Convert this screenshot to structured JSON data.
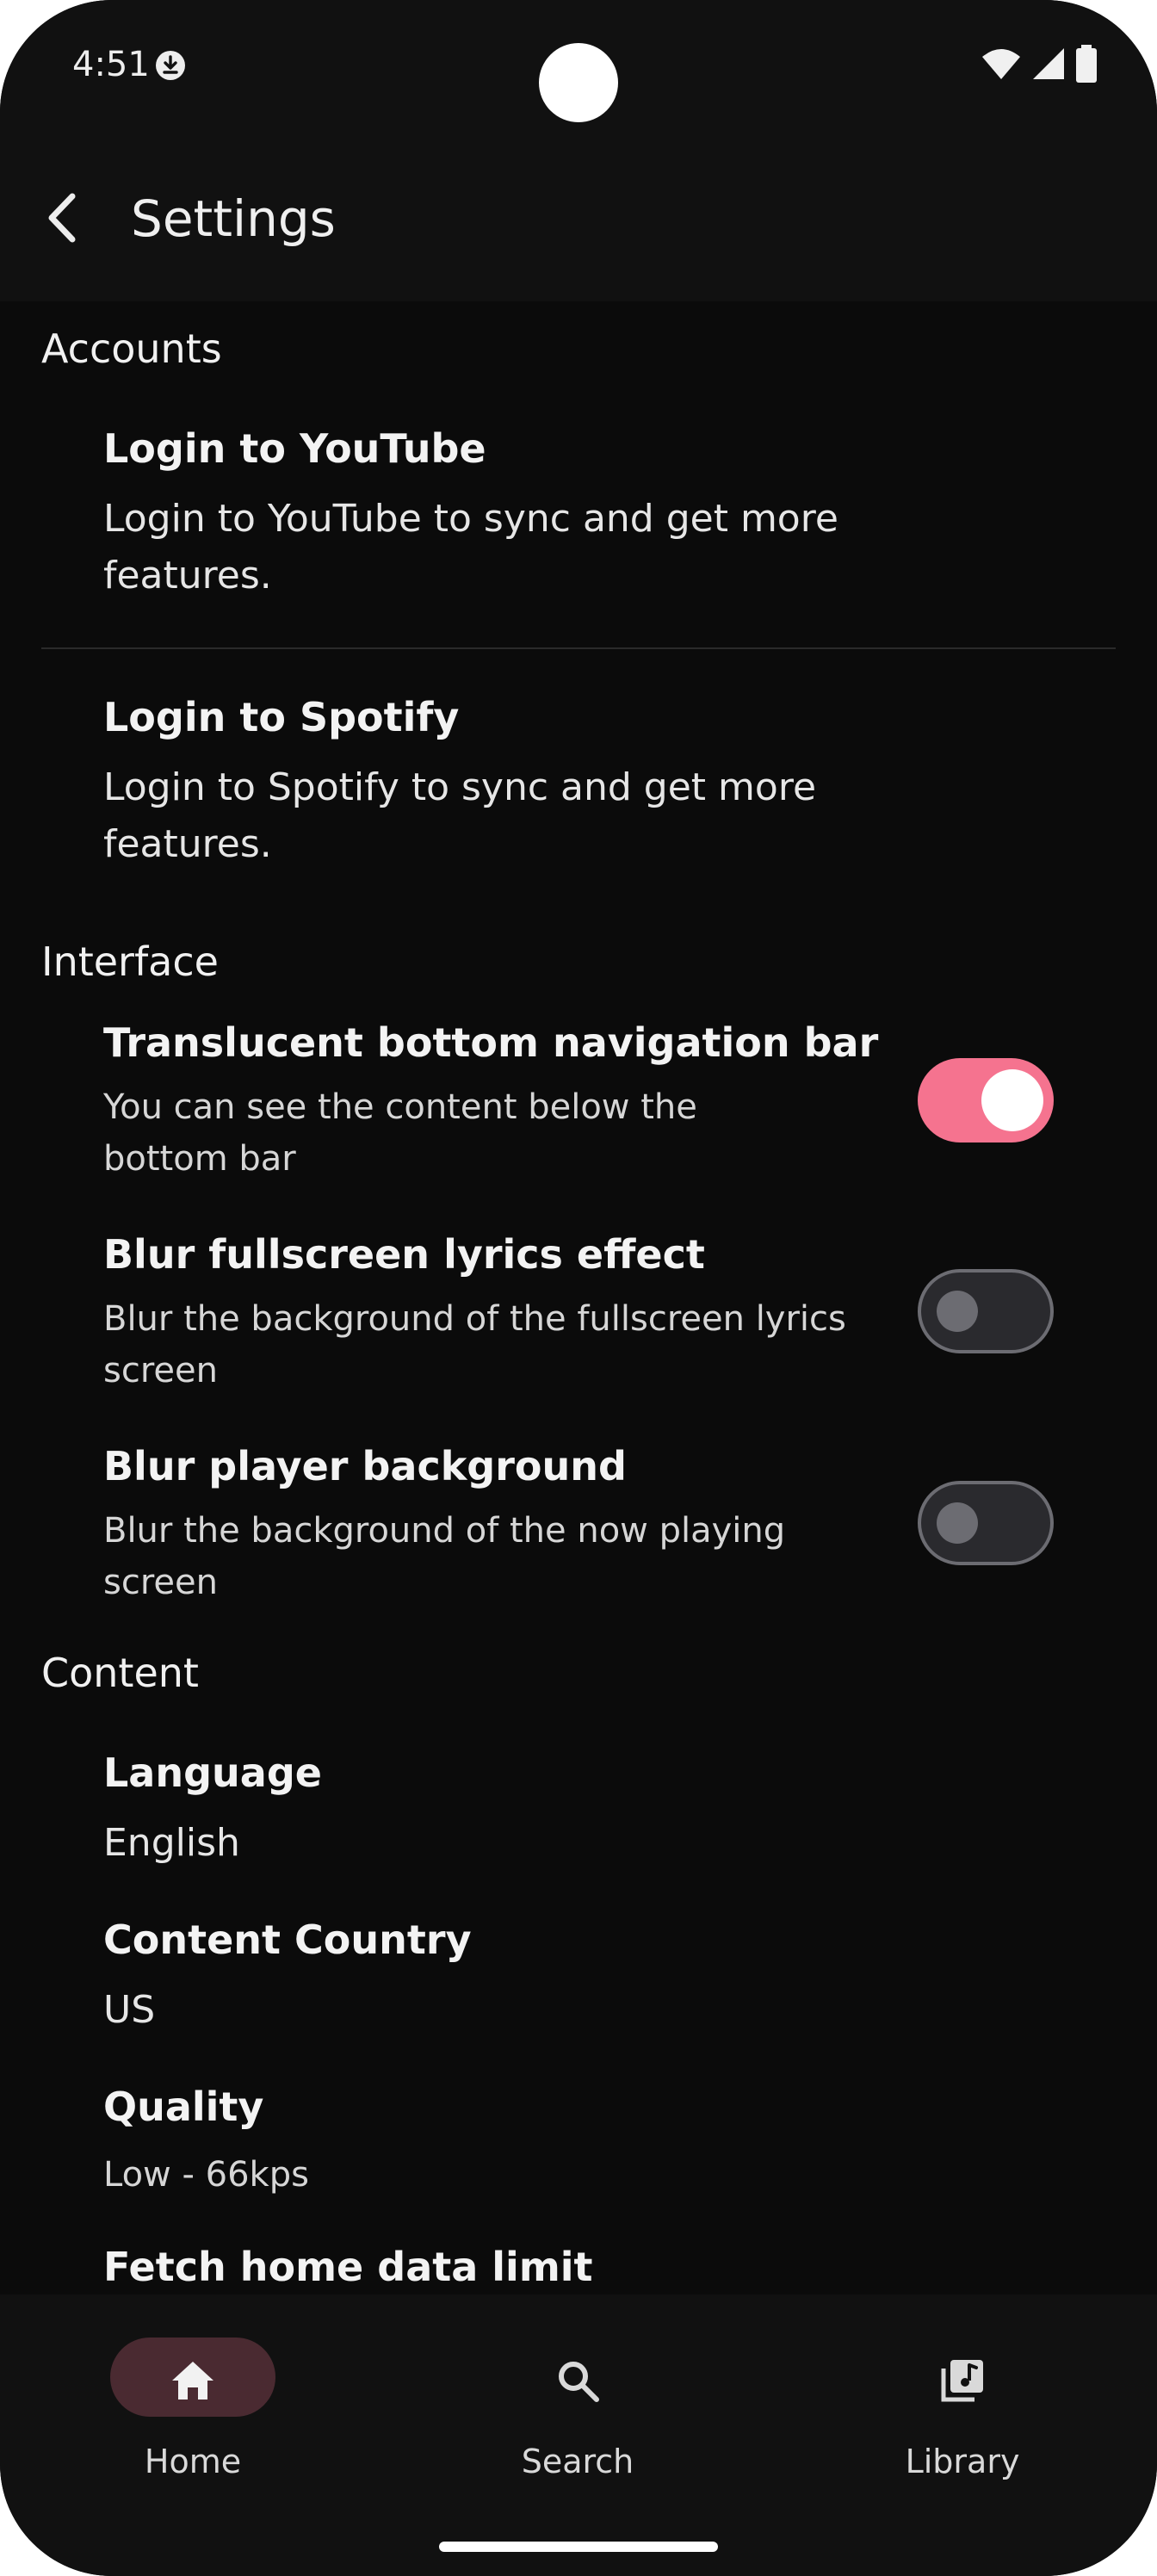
{
  "status_bar": {
    "time": "4:51"
  },
  "app_bar": {
    "title": "Settings"
  },
  "sections": {
    "accounts": {
      "title": "Accounts",
      "youtube": {
        "title": "Login to YouTube",
        "desc_line1": "Login to YouTube to sync and get more",
        "desc_line2": "features."
      },
      "spotify": {
        "title": "Login to Spotify",
        "desc_line1": "Login to Spotify to sync and get more",
        "desc_line2": "features."
      }
    },
    "interface": {
      "title": "Interface",
      "translucent": {
        "title": "Translucent bottom navigation bar",
        "desc_line1": "You can see the content below the",
        "desc_line2": "bottom bar",
        "enabled": true
      },
      "blur_lyrics": {
        "title": "Blur fullscreen lyrics effect",
        "desc_line1": "Blur the background of the fullscreen lyrics",
        "desc_line2": "screen",
        "enabled": false
      },
      "blur_player": {
        "title": "Blur player background",
        "desc_line1": "Blur the background of the now playing",
        "desc_line2": "screen",
        "enabled": false
      }
    },
    "content": {
      "title": "Content",
      "language": {
        "title": "Language",
        "value": "English"
      },
      "country": {
        "title": "Content Country",
        "value": "US"
      },
      "quality": {
        "title": "Quality",
        "value": "Low - 66kps"
      },
      "fetch_limit": {
        "title": "Fetch home data limit"
      }
    }
  },
  "bottom_nav": {
    "items": [
      {
        "label": "Home",
        "icon": "home-icon",
        "active": true
      },
      {
        "label": "Search",
        "icon": "search-icon",
        "active": false
      },
      {
        "label": "Library",
        "icon": "library-icon",
        "active": false
      }
    ]
  },
  "colors": {
    "accent": "#f5738f",
    "nav_active": "#4a2a31",
    "background": "#0b0b0b"
  }
}
